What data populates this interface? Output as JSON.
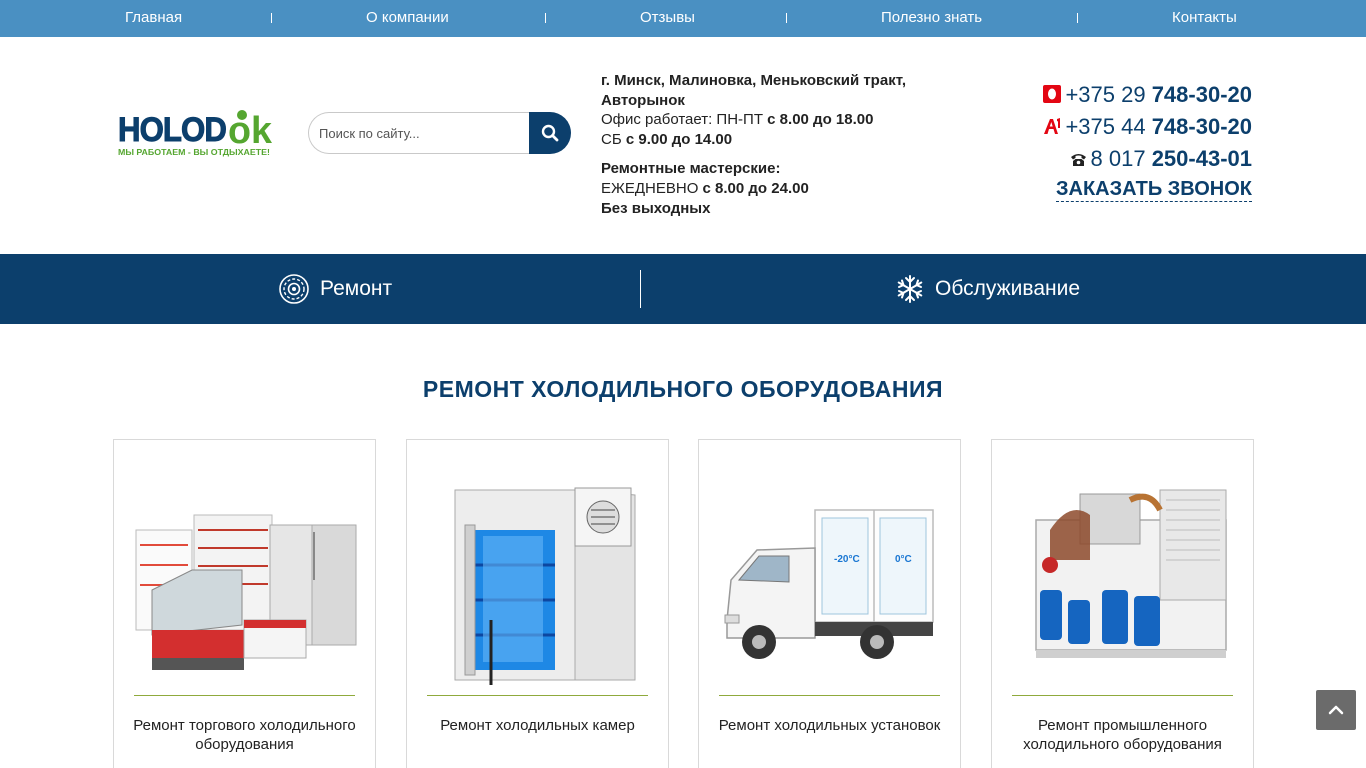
{
  "nav": {
    "items": [
      {
        "label": "Главная"
      },
      {
        "label": "О компании"
      },
      {
        "label": "Отзывы"
      },
      {
        "label": "Полезно знать"
      },
      {
        "label": "Контакты"
      }
    ]
  },
  "header": {
    "logo_text": "HOLODOK",
    "logo_slogan": "МЫ РАБОТАЕМ - ВЫ ОТДЫХАЕТЕ!",
    "search_placeholder": "Поиск по сайту...",
    "address_line1": "г. Минск, Малиновка, Меньковский тракт,",
    "address_line2": "Авторынок",
    "office_label": "Офис работает: ПН-ПТ ",
    "office_hours": "с 8.00 до 18.00",
    "sat_label": "СБ ",
    "sat_hours": "с 9.00 до 14.00",
    "workshops_label": "Ремонтные мастерские:",
    "daily_label": "ЕЖЕДНЕВНО ",
    "daily_hours": "с 8.00 до 24.00",
    "no_days_off": "Без выходных",
    "phones": [
      {
        "operator": "mts-icon",
        "prefix": "+375 29 ",
        "number": "748-30-20"
      },
      {
        "operator": "a1-icon",
        "prefix": "+375 44 ",
        "number": "748-30-20"
      },
      {
        "operator": "landline-phone-icon",
        "prefix": "8 017 ",
        "number": "250-43-01"
      }
    ],
    "callback_label": "ЗАКАЗАТЬ ЗВОНОК"
  },
  "services": {
    "repair_label": "Ремонт",
    "service_label": "Обслуживание"
  },
  "section": {
    "title": "РЕМОНТ ХОЛОДИЛЬНОГО ОБОРУДОВАНИЯ"
  },
  "cards": [
    {
      "title": "Ремонт торгового холодильного оборудования"
    },
    {
      "title": "Ремонт холодильных камер"
    },
    {
      "title": "Ремонт холодильных установок",
      "temp_left": "-20°C",
      "temp_right": "0°C"
    },
    {
      "title": "Ремонт промышленного холодильного оборудования"
    }
  ],
  "colors": {
    "nav_bg": "#4a90c2",
    "brand_dark": "#0c3f6c",
    "accent_green": "#8faa3c",
    "mts_red": "#e30613"
  }
}
